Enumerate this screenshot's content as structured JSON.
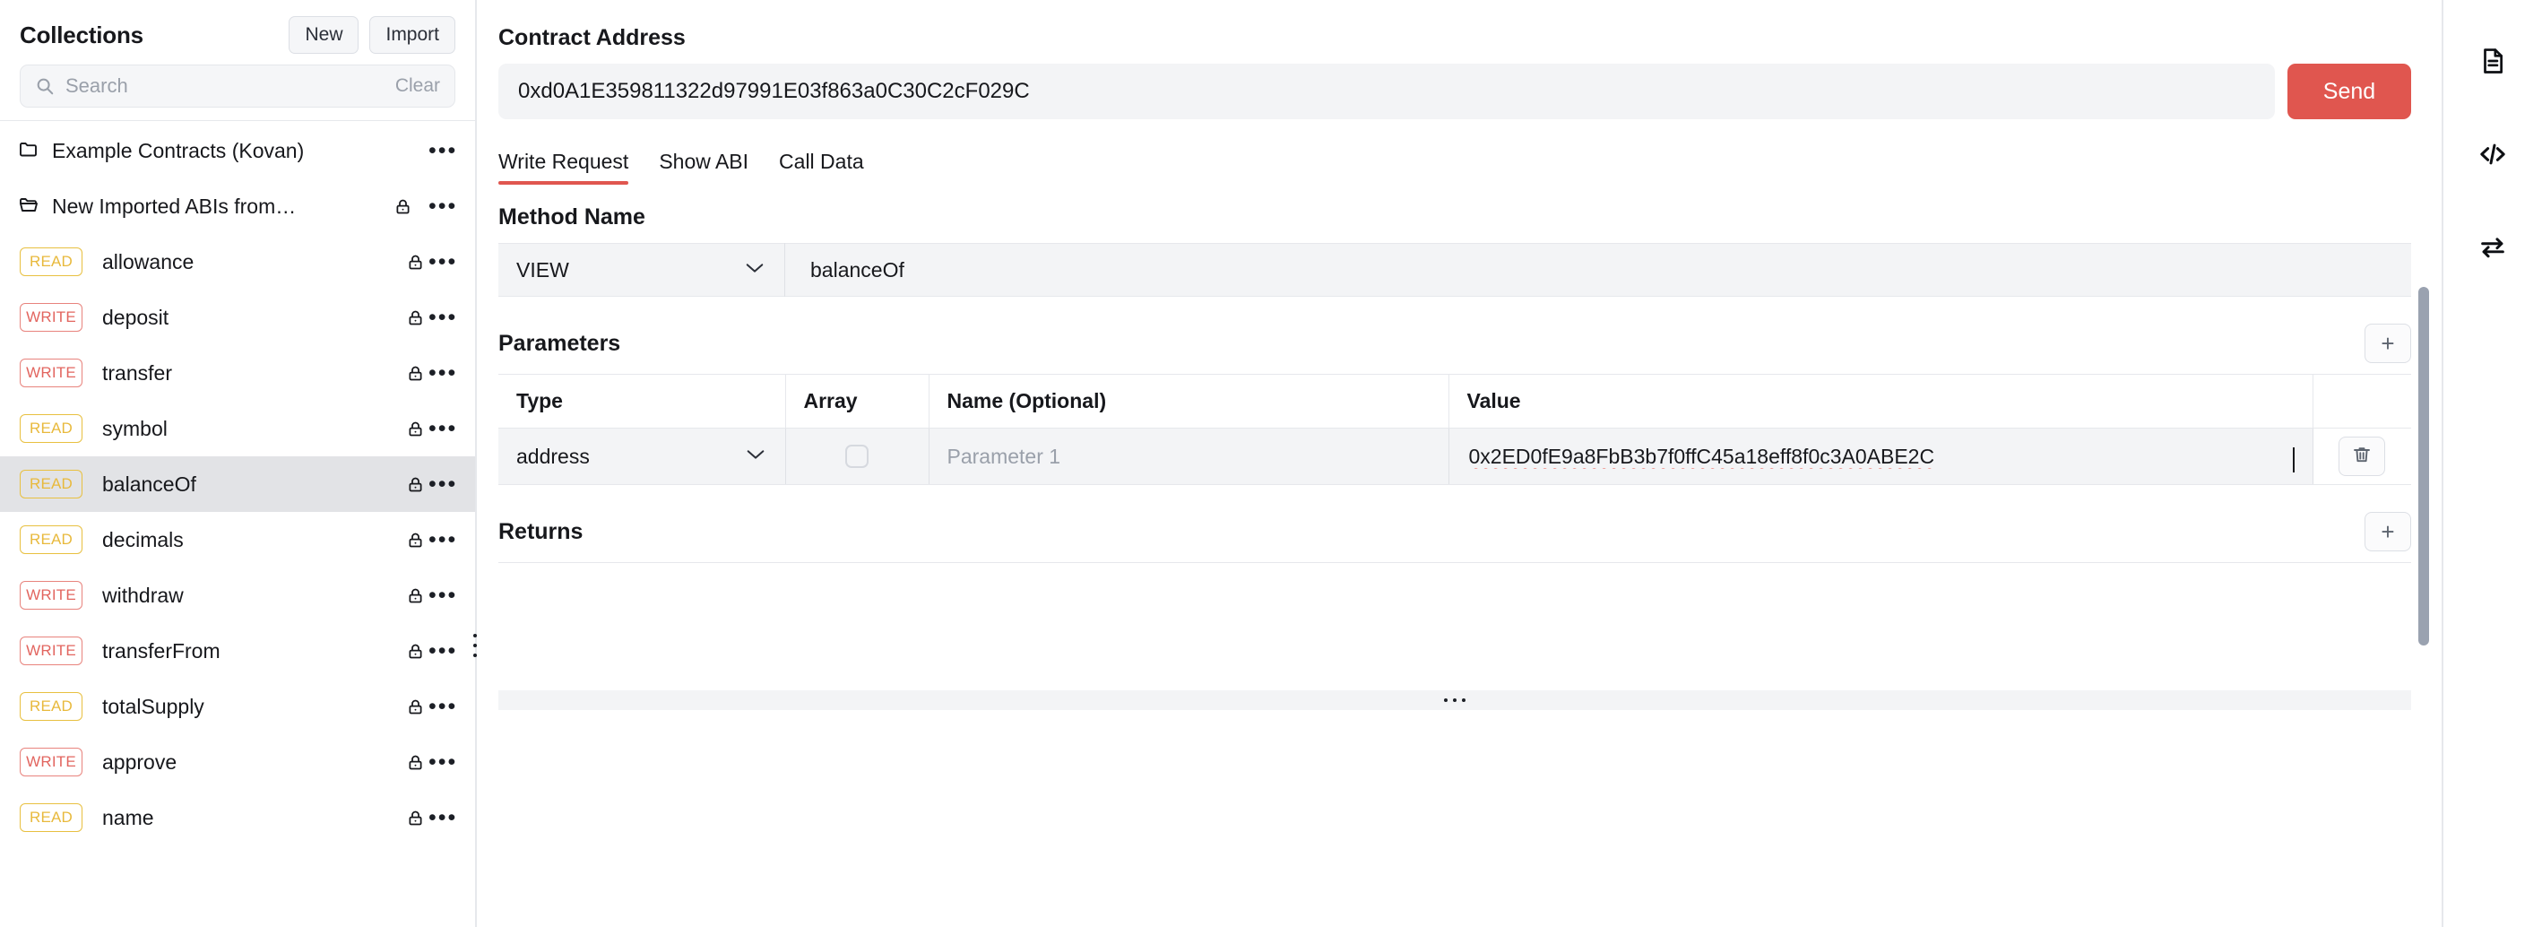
{
  "sidebar": {
    "title": "Collections",
    "new_label": "New",
    "import_label": "Import",
    "search": {
      "placeholder": "Search",
      "value": "",
      "clear_label": "Clear",
      "icon": "search-icon"
    },
    "folders": [
      {
        "label": "Example Contracts (Kovan)",
        "icon": "folder-closed-icon",
        "locked": false,
        "menu": "•••"
      },
      {
        "label": "New Imported ABIs from…",
        "icon": "folder-open-icon",
        "locked": true,
        "menu": "•••"
      }
    ],
    "methods": [
      {
        "badge": "READ",
        "kind": "read",
        "name": "allowance",
        "locked": true,
        "selected": false,
        "menu": "•••"
      },
      {
        "badge": "WRITE",
        "kind": "write",
        "name": "deposit",
        "locked": true,
        "selected": false,
        "menu": "•••"
      },
      {
        "badge": "WRITE",
        "kind": "write",
        "name": "transfer",
        "locked": true,
        "selected": false,
        "menu": "•••"
      },
      {
        "badge": "READ",
        "kind": "read",
        "name": "symbol",
        "locked": true,
        "selected": false,
        "menu": "•••"
      },
      {
        "badge": "READ",
        "kind": "read",
        "name": "balanceOf",
        "locked": true,
        "selected": true,
        "menu": "•••"
      },
      {
        "badge": "READ",
        "kind": "read",
        "name": "decimals",
        "locked": true,
        "selected": false,
        "menu": "•••"
      },
      {
        "badge": "WRITE",
        "kind": "write",
        "name": "withdraw",
        "locked": true,
        "selected": false,
        "menu": "•••"
      },
      {
        "badge": "WRITE",
        "kind": "write",
        "name": "transferFrom",
        "locked": true,
        "selected": false,
        "menu": "•••"
      },
      {
        "badge": "READ",
        "kind": "read",
        "name": "totalSupply",
        "locked": true,
        "selected": false,
        "menu": "•••"
      },
      {
        "badge": "WRITE",
        "kind": "write",
        "name": "approve",
        "locked": true,
        "selected": false,
        "menu": "•••"
      },
      {
        "badge": "READ",
        "kind": "read",
        "name": "name",
        "locked": true,
        "selected": false,
        "menu": "•••"
      }
    ]
  },
  "main": {
    "contract_address_label": "Contract Address",
    "contract_address_value": "0xd0A1E359811322d97991E03f863a0C30C2cF029C",
    "contract_address_placeholder": "Contract Address",
    "send_label": "Send",
    "tabs": [
      {
        "label": "Write Request",
        "active": true
      },
      {
        "label": "Show ABI",
        "active": false
      },
      {
        "label": "Call Data",
        "active": false
      }
    ],
    "method_name_label": "Method Name",
    "mutability_selected": "VIEW",
    "method_value": "balanceOf",
    "parameters_label": "Parameters",
    "add_parameter_label": "+",
    "columns": [
      "Type",
      "Array",
      "Name (Optional)",
      "Value"
    ],
    "rows": [
      {
        "type": "address",
        "array_checked": false,
        "name_placeholder": "Parameter 1",
        "name_value": "",
        "value": "0x2ED0fE9a8FbB3b7f0ffC45a18eff8f0c3A0ABE2C",
        "delete_icon": "trash-icon"
      }
    ],
    "returns_label": "Returns",
    "add_return_label": "+"
  },
  "right_rail": {
    "items": [
      {
        "icon": "document-icon"
      },
      {
        "icon": "code-icon"
      },
      {
        "icon": "swap-arrows-icon"
      }
    ]
  },
  "colors": {
    "accent_red": "#e0564f",
    "read_badge": "#e8c040",
    "write_badge": "#e8837d",
    "selected_row": "#e2e3e6",
    "field_bg": "#f3f4f6"
  }
}
